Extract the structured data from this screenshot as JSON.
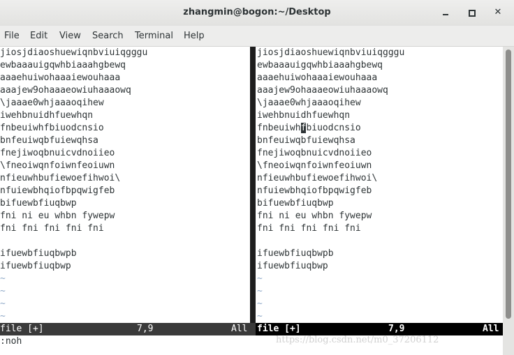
{
  "window": {
    "title": "zhangmin@bogon:~/Desktop"
  },
  "menu": [
    "File",
    "Edit",
    "View",
    "Search",
    "Terminal",
    "Help"
  ],
  "left_pane": {
    "lines": [
      "jiosjdiaoshuewiqnbviuiqgggu",
      "ewbaaauigqwhbiaaahgbewq",
      "aaaehuiwohaaaiewouhaaa",
      "aaajew9ohaaaeowiuhaaaowq",
      "\\jaaae0whjaaaoqihew",
      "iwehbnuidhfuewhqn",
      "fnbeuiwhfbiuodcnsio",
      "bnfeuiwqbfuiewqhsa",
      "fnejiwoqbnuicvdnoiieo",
      "\\fneoiwqnfoiwnfeoiuwn",
      "nfieuwhbufiewoefihwoi\\",
      "nfuiewbhqiofbpqwigfeb",
      "bifuewbfiuqbwp",
      "fni ni eu whbn fywepw",
      "fni fni fni fni fni",
      "",
      "ifuewbfiuqbwpb",
      "ifuewbfiuqbwp"
    ],
    "tildes": [
      "~",
      "~",
      "~",
      "~"
    ],
    "status": {
      "file": "file [+]",
      "pos": "7,9",
      "scroll": "All"
    }
  },
  "right_pane": {
    "lines": [
      "jiosjdiaoshuewiqnbviuiqgggu",
      "ewbaaauigqwhbiaaahgbewq",
      "aaaehuiwohaaaiewouhaaa",
      "aaajew9ohaaaeowiuhaaaowq",
      "\\jaaae0whjaaaoqihew",
      "iwehbnuidhfuewhqn",
      "fnbeuiwhfbiuodcnsio",
      "bnfeuiwqbfuiewqhsa",
      "fnejiwoqbnuicvdnoiieo",
      "\\fneoiwqnfoiwnfeoiuwn",
      "nfieuwhbufiewoefihwoi\\",
      "nfuiewbhqiofbpqwigfeb",
      "bifuewbfiuqbwp",
      "fni ni eu whbn fywepw",
      "fni fni fni fni fni",
      "",
      "ifuewbfiuqbwpb",
      "ifuewbfiuqbwp"
    ],
    "tildes": [
      "~",
      "~",
      "~",
      "~"
    ],
    "cursor": {
      "line": 7,
      "column": 9
    },
    "status": {
      "file": "file [+]",
      "pos": "7,9",
      "scroll": "All"
    }
  },
  "command_line": ":noh",
  "watermark": "https://blog.csdn.net/m0_37206112",
  "colors": {
    "tilde": "#8fa9c8",
    "status_active": "#000000",
    "status_inactive": "#3a3a3a"
  }
}
